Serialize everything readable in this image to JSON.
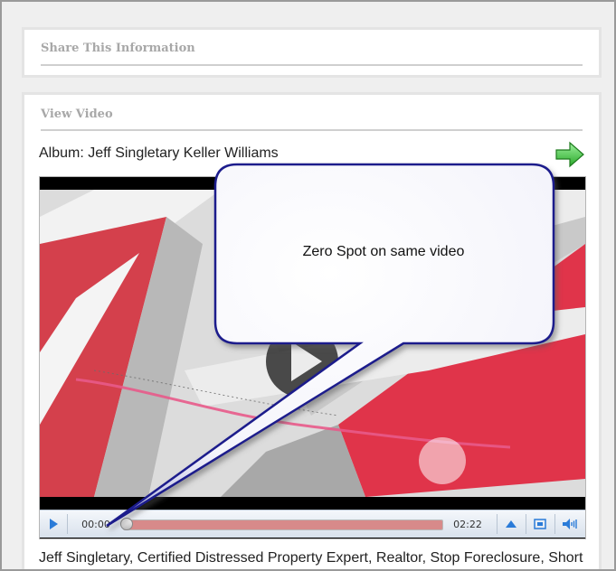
{
  "share_panel": {
    "title": "Share This Information"
  },
  "video_panel": {
    "title": "View Video",
    "album_title": "Album: Jeff Singletary Keller Williams",
    "next_icon": "green-arrow-right-icon",
    "player": {
      "current_time": "00:00",
      "duration": "02:22",
      "progress_fraction": 0,
      "buffered_fraction": 1.0,
      "icons": {
        "play": "play-icon",
        "up": "triangle-up-icon",
        "fullscreen": "fullscreen-icon",
        "volume": "speaker-icon"
      },
      "accent_color": "#d78a8a"
    },
    "description": "Jeff Singletary, Certified Distressed Property Expert, Realtor, Stop Foreclosure, Short"
  },
  "callout": {
    "text": "Zero Spot on same video"
  },
  "colors": {
    "callout_border": "#1a1a8c",
    "arrow_green": "#3cc23c"
  }
}
